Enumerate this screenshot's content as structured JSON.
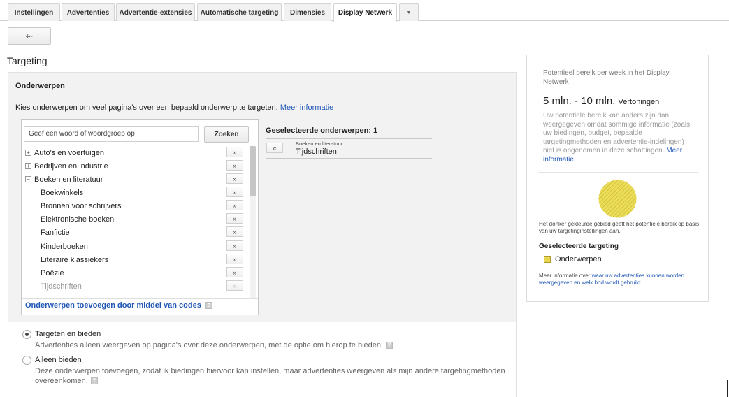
{
  "tabs": [
    {
      "label": "Instellingen",
      "active": false
    },
    {
      "label": "Advertenties",
      "active": false
    },
    {
      "label": "Advertentie-extensies",
      "active": false
    },
    {
      "label": "Automatische targeting",
      "active": false
    },
    {
      "label": "Dimensies",
      "active": false
    },
    {
      "label": "Display Netwerk",
      "active": true
    }
  ],
  "tab_more_icon": "chevron-down-icon",
  "back_button": {
    "icon": "back-arrow-icon",
    "glyph": "⇜"
  },
  "page_title": "Targeting",
  "topics": {
    "heading": "Onderwerpen",
    "description": "Kies onderwerpen om veel pagina's over een bepaald onderwerp te targeten.",
    "more_info_link": "Meer informatie",
    "search": {
      "value": "Geef een woord of woordgroep op",
      "button_label": "Zoeken"
    },
    "tree": [
      {
        "label": "Auto's en voertuigen",
        "expander": "+",
        "level": 0,
        "muted": false
      },
      {
        "label": "Bedrijven en industrie",
        "expander": "+",
        "level": 0,
        "muted": false
      },
      {
        "label": "Boeken en literatuur",
        "expander": "−",
        "level": 0,
        "muted": false
      },
      {
        "label": "Boekwinkels",
        "expander": "",
        "level": 1,
        "muted": false
      },
      {
        "label": "Bronnen voor schrijvers",
        "expander": "",
        "level": 1,
        "muted": false
      },
      {
        "label": "Elektronische boeken",
        "expander": "",
        "level": 1,
        "muted": false
      },
      {
        "label": "Fanfictie",
        "expander": "",
        "level": 1,
        "muted": false
      },
      {
        "label": "Kinderboeken",
        "expander": "",
        "level": 1,
        "muted": false
      },
      {
        "label": "Literaire klassiekers",
        "expander": "",
        "level": 1,
        "muted": false
      },
      {
        "label": "Poëzie",
        "expander": "",
        "level": 1,
        "muted": false
      },
      {
        "label": "Tijdschriften",
        "expander": "",
        "level": 1,
        "muted": true
      }
    ],
    "add_glyph": "»",
    "remove_glyph": "«",
    "add_by_codes_link": "Onderwerpen toevoegen door middel van codes",
    "help_glyph": "?",
    "selected_heading": "Geselecteerde onderwerpen: 1",
    "selected": [
      {
        "parent": "Boeken en literatuur",
        "label": "Tijdschriften"
      }
    ]
  },
  "options": [
    {
      "title": "Targeten en bieden",
      "description": "Advertenties alleen weergeven op pagina's over deze onderwerpen, met de optie om hierop te bieden.",
      "checked": true
    },
    {
      "title": "Alleen bieden",
      "description_line1": "Deze onderwerpen toevoegen, zodat ik biedingen hiervoor kan instellen, maar advertenties weergeven als mijn andere targetingmethoden",
      "description_line2": "overeenkomen.",
      "checked": false
    }
  ],
  "reach": {
    "label": "Potentieel bereik per week in het Display Netwerk",
    "value": "5 mln. - 10 mln.",
    "unit": "Vertoningen",
    "note": "Uw potentiële bereik kan anders zijn dan weergegeven omdat sommige informatie (zoals uw biedingen, budget, bepaalde targetingmethoden en advertentie-indelingen) niet is opgenomen in deze schattingen.",
    "note_link": "Meer informatie",
    "circle_note": "Het donker gekleurde gebied geeft het potentiële bereik op basis van uw targetinginstellingen aan.",
    "selected_targeting_heading": "Geselecteerde targeting",
    "legend_label": "Onderwerpen",
    "more_info_prefix": "Meer informatie over",
    "more_info_link": "waar uw advertenties kunnen worden weergegeven en welk bod wordt gebruikt.",
    "accent_color": "#e3d23c"
  }
}
